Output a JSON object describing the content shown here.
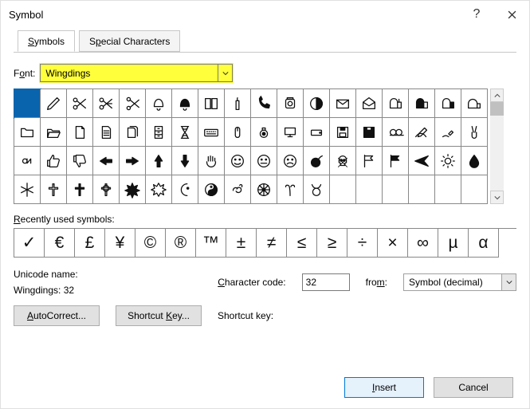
{
  "window": {
    "title": "Symbol",
    "help_icon": "?",
    "close_icon": "close"
  },
  "tabs": {
    "symbols": "Symbols",
    "special": "Special Characters"
  },
  "font": {
    "label_pre": "F",
    "label_accel": "o",
    "label_post": "nt:",
    "value": "Wingdings"
  },
  "recent_label_accel": "R",
  "recent_label_rest": "ecently used symbols:",
  "recent_symbols": [
    "✓",
    "€",
    "£",
    "¥",
    "©",
    "®",
    "™",
    "±",
    "≠",
    "≤",
    "≥",
    "÷",
    "×",
    "∞",
    "µ",
    "α"
  ],
  "unicode": {
    "name_label": "Unicode name:",
    "name_value": "Wingdings: 32",
    "char_label_accel": "C",
    "char_label_rest": "haracter code:",
    "char_value": "32",
    "from_label": "fro",
    "from_label_accel": "m",
    "from_label_post": ":",
    "from_value": "Symbol (decimal)"
  },
  "buttons": {
    "autocorrect_accel": "A",
    "autocorrect_rest": "utoCorrect...",
    "shortcut_pre": "Shortcut ",
    "shortcut_accel": "K",
    "shortcut_post": "ey...",
    "shortcutkey_label": "Shortcut key:",
    "insert_accel": "I",
    "insert_rest": "nsert",
    "cancel": "Cancel"
  },
  "grid": {
    "selected_index": 0,
    "total_cells": 72,
    "glyphs": {
      "1": "pencil",
      "2": "scissors",
      "3": "scissors2",
      "4": "scissors3",
      "5": "bell",
      "6": "bell2",
      "7": "book",
      "8": "candle",
      "9": "phone",
      "10": "phone2",
      "11": "halfmoon",
      "12": "envelope",
      "13": "mailopen",
      "14": "mailbox",
      "15": "mailbox2",
      "16": "mailbox3",
      "17": "mailbox4",
      "18": "folder",
      "19": "folderopen",
      "20": "doc",
      "21": "doc2",
      "22": "docs",
      "23": "filecab",
      "24": "hourglass",
      "25": "keyboard",
      "26": "mouse",
      "27": "trackball",
      "28": "computer",
      "29": "harddisk",
      "30": "floppy",
      "31": "floppy2",
      "32": "tape",
      "33": "writing",
      "34": "handwrite",
      "35": "victory",
      "36": "ok",
      "37": "thumbup",
      "38": "thumbdown",
      "39": "pointleft",
      "40": "pointright",
      "41": "pointup",
      "42": "pointdown",
      "43": "openhand",
      "44": "smile",
      "45": "neutralface",
      "46": "frown",
      "47": "bomb",
      "48": "skull",
      "49": "flagoutline",
      "50": "flag",
      "51": "plane",
      "52": "sun",
      "53": "drop",
      "54": "snow",
      "55": "cross",
      "56": "cross2",
      "57": "celtic",
      "58": "maltese",
      "59": "star6",
      "60": "crescent",
      "61": "yinyang",
      "62": "om",
      "63": "wheel",
      "64": "aries",
      "65": "taurus"
    }
  }
}
